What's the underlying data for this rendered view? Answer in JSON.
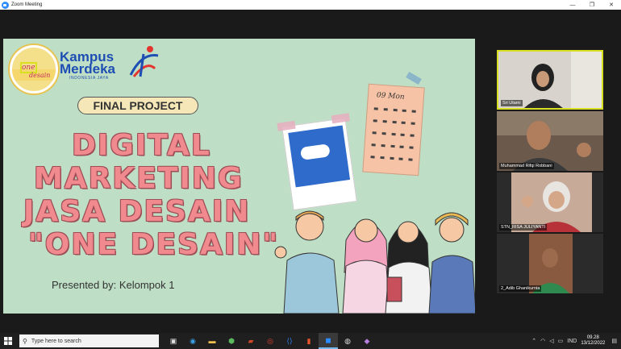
{
  "window": {
    "title": "Zoom Meeting",
    "min_icon": "minimize-icon",
    "max_icon": "maximize-icon",
    "close_icon": "close-icon"
  },
  "slide": {
    "logo_one_desain": [
      "one",
      "desain"
    ],
    "kampus_line1": "Kampus",
    "kampus_line2": "Merdeka",
    "kampus_sub": "INDONESIA JAYA",
    "badge": "FINAL PROJECT",
    "title_lines": [
      "DIGITAL",
      "MARKETING",
      "JASA DESAIN",
      "\"ONE DESAIN\""
    ],
    "presented": "Presented by: Kelompok 1",
    "calendar_month": "09 Mon"
  },
  "participants": [
    {
      "name": "Sri Utami",
      "active": true
    },
    {
      "name": "Muhammad Rifqi Robbani",
      "active": false
    },
    {
      "name": "STN_RISA JULIYANTI",
      "active": false
    },
    {
      "name": "2_Adib Ghanikurnia",
      "active": false
    }
  ],
  "taskbar": {
    "search_placeholder": "Type here to search",
    "lang": "IND",
    "time": "09.28",
    "date": "13/12/2022"
  },
  "colors": {
    "slide_bg": "#BEDFC5",
    "title_fill": "#F08A8E",
    "active_speaker": "#D9E021",
    "zoom_blue": "#2D8CFF"
  }
}
